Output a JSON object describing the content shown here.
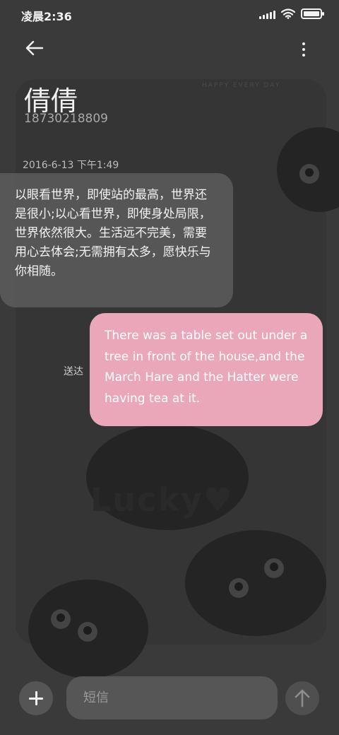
{
  "status_bar": {
    "time": "凌晨2:36",
    "icons": [
      "signal-icon",
      "wifi-icon",
      "battery-icon"
    ],
    "battery_level": 1.0
  },
  "header": {
    "back_icon": "arrow-left-icon",
    "more_icon": "more-vertical-icon",
    "contact_name": "倩倩",
    "contact_number": "18730218809"
  },
  "conversation": {
    "date_label": "2016-6-13 下午1:49",
    "incoming": {
      "text": "以眼看世界，即使站的最高，世界还是很小;以心看世界，即使身处局限，世界依然很大。生活远不完美，需要用心去体会;无需拥有太多，愿快乐与你相随。"
    },
    "outgoing": {
      "text": "There was a table set out under a tree in front of the house,and the March Hare and the Hatter were having tea at it.",
      "status": "送达"
    }
  },
  "composer": {
    "add_icon": "plus-icon",
    "placeholder": "短信",
    "send_icon": "arrow-up-icon"
  },
  "colors": {
    "background": "#3a3a3a",
    "incoming_bubble": "#606060",
    "outgoing_bubble": "#eaa7ba",
    "input_bg": "#565656"
  }
}
